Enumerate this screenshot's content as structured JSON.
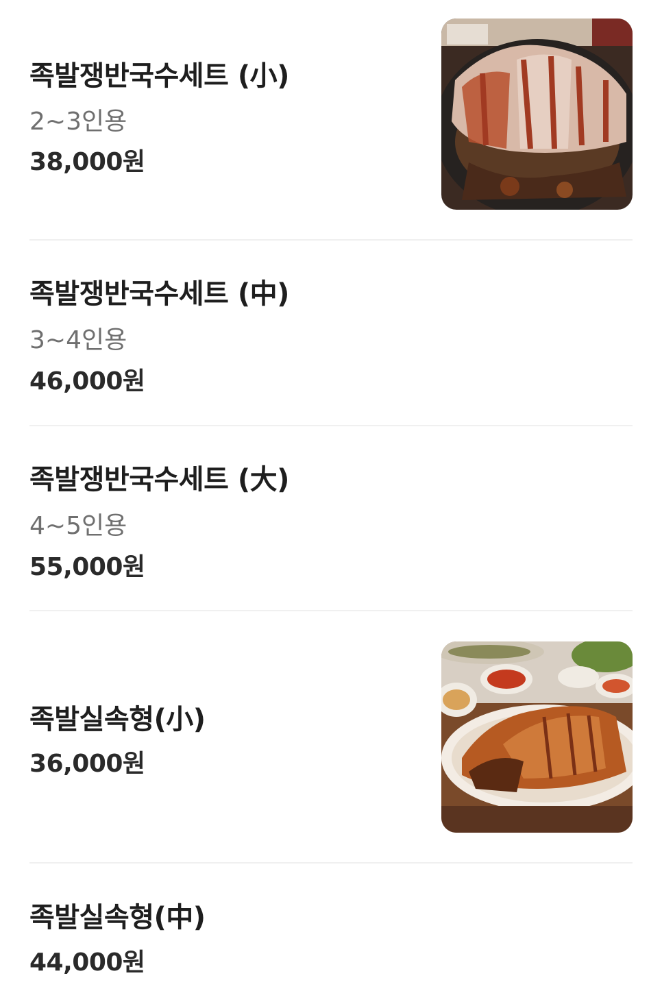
{
  "menu_items": [
    {
      "name": "족발쟁반국수세트 (小)",
      "desc": "2~3인용",
      "price": "38,000원",
      "has_image": true,
      "image_icon": "pork-hocks-tray-photo"
    },
    {
      "name": "족발쟁반국수세트 (中)",
      "desc": "3~4인용",
      "price": "46,000원",
      "has_image": false
    },
    {
      "name": "족발쟁반국수세트 (大)",
      "desc": "4~5인용",
      "price": "55,000원",
      "has_image": false
    },
    {
      "name": "족발실속형(小)",
      "price": "36,000원",
      "has_image": true,
      "image_icon": "pork-hocks-platter-photo"
    },
    {
      "name": "족발실속형(中)",
      "price": "44,000원",
      "has_image": false
    }
  ],
  "colors": {
    "name": "#1e1e1e",
    "desc": "#6f6f6f",
    "price": "#2a2a2a",
    "divider": "#f0f0f0"
  }
}
